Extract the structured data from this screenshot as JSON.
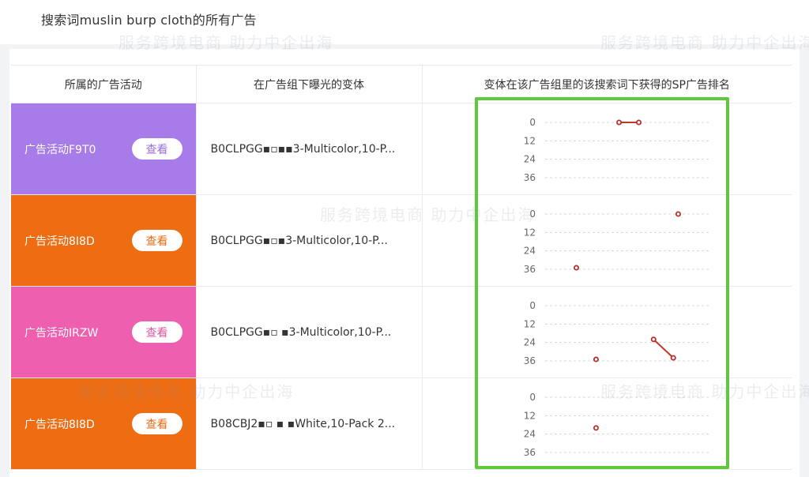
{
  "header": {
    "title": "搜索词muslin burp cloth的所有广告"
  },
  "table": {
    "columns": [
      "所属的广告活动",
      "在广告组下曝光的变体",
      "变体在该广告组里的该搜索词下获得的SP广告排名"
    ],
    "view_label": "查看",
    "rows": [
      {
        "campaign": "广告活动F9T0",
        "variant": "B0CLPGG▪▫▪▪3-Multicolor,10-P...",
        "color": "#a87ce8",
        "btn_color": "#9a6ee0",
        "ranks": [
          {
            "x": 0.45,
            "y": 0
          },
          {
            "x": 0.57,
            "y": 0
          }
        ],
        "connected": true
      },
      {
        "campaign": "广告活动8I8D",
        "variant": "B0CLPGG▪▫▪3-Multicolor,10-P...",
        "color": "#ef6d12",
        "btn_color": "#ef6d12",
        "ranks": [
          {
            "x": 0.19,
            "y": 35
          },
          {
            "x": 0.81,
            "y": 0
          }
        ],
        "connected": false
      },
      {
        "campaign": "广告活动IRZW",
        "variant": "B0CLPGG▪▫ ▪3-Multicolor,10-P...",
        "color": "#ef5fb0",
        "btn_color": "#e4569f",
        "ranks": [
          {
            "x": 0.31,
            "y": 35
          },
          {
            "x": 0.66,
            "y": 22
          },
          {
            "x": 0.78,
            "y": 34
          }
        ],
        "connected_pairs": [
          [
            1,
            2
          ]
        ]
      },
      {
        "campaign": "广告活动8I8D",
        "variant": "B08CBJ2▪▫ ▪ ▪White,10-Pack 2...",
        "color": "#ef6d12",
        "btn_color": "#ef6d12",
        "ranks": [
          {
            "x": 0.31,
            "y": 20
          }
        ],
        "connected": false
      }
    ]
  },
  "chart_data": [
    {
      "type": "scatter",
      "y_ticks": [
        0,
        12,
        24,
        36
      ],
      "ylim": [
        0,
        36
      ],
      "y_inverted": true,
      "series": [
        {
          "points": [
            [
              0.45,
              0
            ],
            [
              0.57,
              0
            ]
          ]
        }
      ]
    },
    {
      "type": "scatter",
      "y_ticks": [
        0,
        12,
        24,
        36
      ],
      "ylim": [
        0,
        36
      ],
      "y_inverted": true,
      "series": [
        {
          "points": [
            [
              0.19,
              35
            ],
            [
              0.81,
              0
            ]
          ]
        }
      ]
    },
    {
      "type": "scatter",
      "y_ticks": [
        0,
        12,
        24,
        36
      ],
      "ylim": [
        0,
        36
      ],
      "y_inverted": true,
      "series": [
        {
          "points": [
            [
              0.31,
              35
            ],
            [
              0.66,
              22
            ],
            [
              0.78,
              34
            ]
          ]
        }
      ]
    },
    {
      "type": "scatter",
      "y_ticks": [
        0,
        12,
        24,
        36
      ],
      "ylim": [
        0,
        36
      ],
      "y_inverted": true,
      "series": [
        {
          "points": [
            [
              0.31,
              20
            ]
          ]
        }
      ]
    }
  ],
  "colors": {
    "point": "#b5312b",
    "line": "#c0392b",
    "highlight": "#5dc93b",
    "grid": "#d9d9d9"
  },
  "watermark": {
    "slogan": "服务跨境电商 助力中企出海"
  }
}
